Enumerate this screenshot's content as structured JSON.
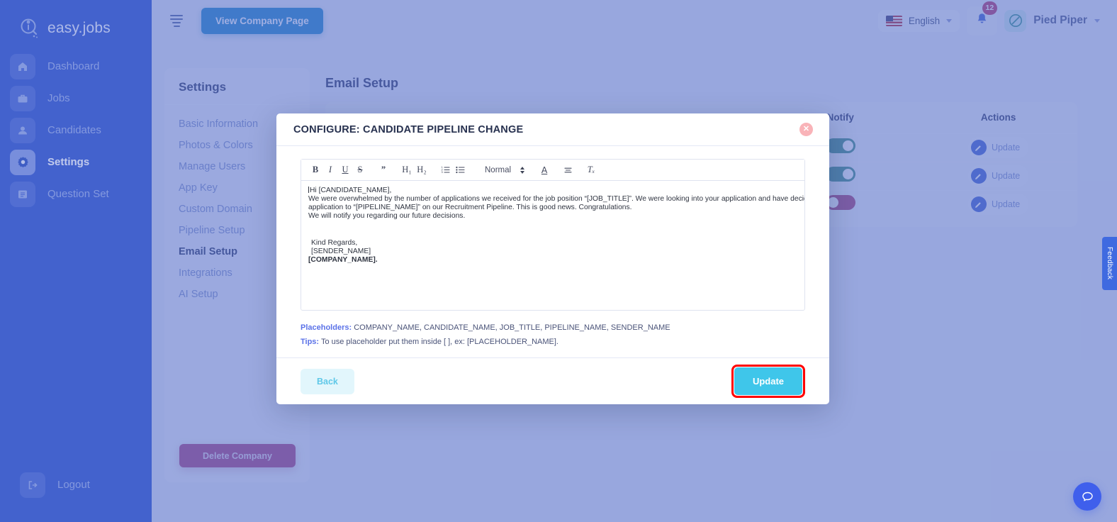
{
  "brand": {
    "name": "easy.jobs",
    "logo_icon": "easyjobs-logo-icon"
  },
  "sidebar": {
    "items": [
      {
        "label": "Dashboard",
        "icon": "home-icon",
        "active": false
      },
      {
        "label": "Jobs",
        "icon": "briefcase-icon",
        "active": false
      },
      {
        "label": "Candidates",
        "icon": "users-icon",
        "active": false
      },
      {
        "label": "Settings",
        "icon": "gear-icon",
        "active": true
      },
      {
        "label": "Question Set",
        "icon": "list-icon",
        "active": false
      }
    ],
    "logout": {
      "label": "Logout",
      "icon": "logout-icon"
    }
  },
  "topbar": {
    "menu_icon": "hamburger-icon",
    "view_company_label": "View Company Page",
    "language": {
      "label": "English",
      "flag": "us-flag-icon",
      "chevron": "chevron-down-icon"
    },
    "notifications": {
      "icon": "bell-icon",
      "count": "12"
    },
    "user": {
      "name": "Pied Piper",
      "avatar_icon": "company-avatar-icon",
      "chevron": "chevron-down-icon"
    }
  },
  "settings_panel": {
    "title": "Settings",
    "items": [
      {
        "label": "Basic Information",
        "active": false
      },
      {
        "label": "Photos & Colors",
        "active": false
      },
      {
        "label": "Manage Users",
        "active": false
      },
      {
        "label": "App Key",
        "active": false
      },
      {
        "label": "Custom Domain",
        "active": false
      },
      {
        "label": "Pipeline Setup",
        "active": false
      },
      {
        "label": "Email Setup",
        "active": true
      },
      {
        "label": "Integrations",
        "active": false
      },
      {
        "label": "AI Setup",
        "active": false
      }
    ],
    "delete_company_label": "Delete Company"
  },
  "main": {
    "page_title": "Email Setup",
    "table": {
      "columns": [
        "Notify",
        "Actions"
      ],
      "rows": [
        {
          "notify": "on",
          "action_label": "Update",
          "action_icon": "pencil-icon"
        },
        {
          "notify": "on",
          "action_label": "Update",
          "action_icon": "pencil-icon"
        },
        {
          "notify": "off",
          "action_label": "Update",
          "action_icon": "pencil-icon"
        }
      ]
    }
  },
  "modal": {
    "title": "CONFIGURE: CANDIDATE PIPELINE CHANGE",
    "close_icon": "close-icon",
    "toolbar": {
      "bold": "B",
      "italic": "I",
      "underline": "U",
      "strike": "S",
      "blockquote": "”",
      "h1": "H₁",
      "h2": "H₂",
      "ordered_list": "ordered-list-icon",
      "bullet_list": "bullet-list-icon",
      "format_value": "Normal",
      "text_color": "A",
      "align": "align-icon",
      "clear_format": "Tₓ"
    },
    "body_lines": [
      "Hi [CANDIDATE_NAME],",
      "We were overwhelmed by the number of applications we received for the job position “[JOB_TITLE]”. We were looking into your application and have decided to move your",
      "application to “[PIPELINE_NAME]” on our Recruitment Pipeline. This is good news. Congratulations.",
      "We will notify you regarding our future decisions."
    ],
    "signature_lines": [
      "Kind Regards,",
      "[SENDER_NAME]",
      "[COMPANY_NAME]."
    ],
    "placeholders_label": "Placeholders:",
    "placeholders_value": "COMPANY_NAME, CANDIDATE_NAME, JOB_TITLE, PIPELINE_NAME, SENDER_NAME",
    "tips_label": "Tips:",
    "tips_value": "To use placeholder put them inside [ ], ex: [PLACEHOLDER_NAME].",
    "back_label": "Back",
    "update_label": "Update"
  },
  "widgets": {
    "feedback_label": "Feedback",
    "chat_icon": "chat-bubble-icon"
  },
  "colors": {
    "sidebar_bg": "#3457ce",
    "overlay": "#7f90cc",
    "primary_blue": "#1b84c9",
    "cyan": "#3fc6ea",
    "magenta": "#a93f7d",
    "teal_toggle": "#3f8c84",
    "highlight_red": "#ff0000"
  }
}
